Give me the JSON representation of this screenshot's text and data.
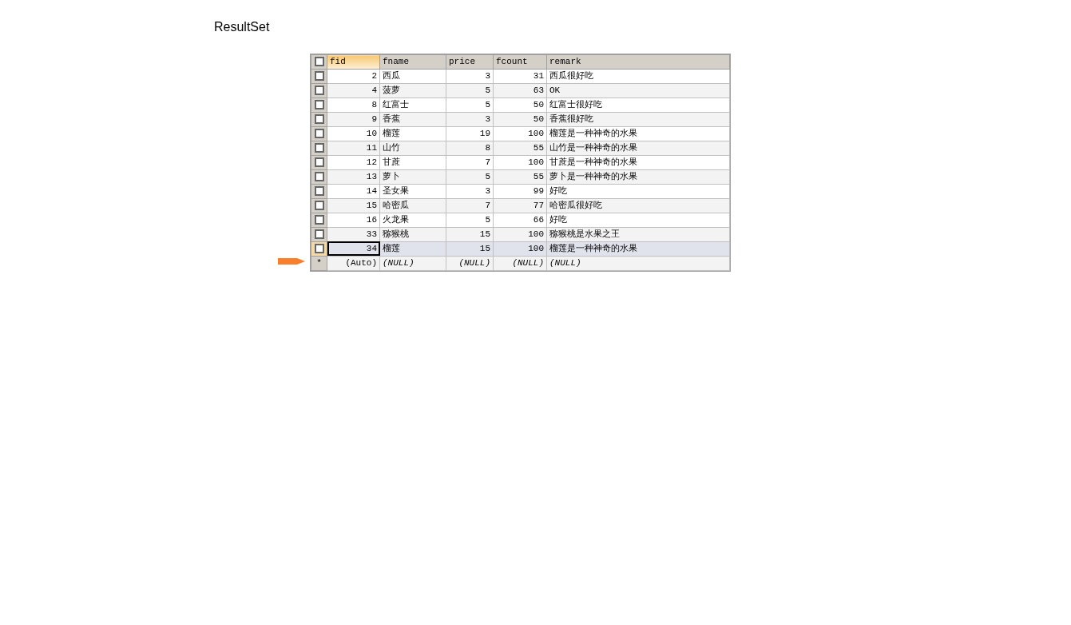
{
  "title": "ResultSet",
  "header_checkbox": {
    "checked": false
  },
  "columns": [
    {
      "label": "fid",
      "selected": true,
      "kind": "number"
    },
    {
      "label": "fname",
      "selected": false,
      "kind": "text"
    },
    {
      "label": "price",
      "selected": false,
      "kind": "number"
    },
    {
      "label": "fcount",
      "selected": false,
      "kind": "number"
    },
    {
      "label": "remark",
      "selected": false,
      "kind": "text"
    }
  ],
  "rows": [
    {
      "cells": [
        "2",
        "西瓜",
        "3",
        "31",
        "西瓜很好吃"
      ],
      "selected": false,
      "checked": false
    },
    {
      "cells": [
        "4",
        "菠萝",
        "5",
        "63",
        "OK"
      ],
      "selected": false,
      "checked": false
    },
    {
      "cells": [
        "8",
        "红富士",
        "5",
        "50",
        "红富士很好吃"
      ],
      "selected": false,
      "checked": false
    },
    {
      "cells": [
        "9",
        "香蕉",
        "3",
        "50",
        "香蕉很好吃"
      ],
      "selected": false,
      "checked": false
    },
    {
      "cells": [
        "10",
        "榴莲",
        "19",
        "100",
        "榴莲是一种神奇的水果"
      ],
      "selected": false,
      "checked": false
    },
    {
      "cells": [
        "11",
        "山竹",
        "8",
        "55",
        "山竹是一种神奇的水果"
      ],
      "selected": false,
      "checked": false
    },
    {
      "cells": [
        "12",
        "甘蔗",
        "7",
        "100",
        "甘蔗是一种神奇的水果"
      ],
      "selected": false,
      "checked": false
    },
    {
      "cells": [
        "13",
        "萝卜",
        "5",
        "55",
        "萝卜是一种神奇的水果"
      ],
      "selected": false,
      "checked": false
    },
    {
      "cells": [
        "14",
        "圣女果",
        "3",
        "99",
        "好吃"
      ],
      "selected": false,
      "checked": false
    },
    {
      "cells": [
        "15",
        "哈密瓜",
        "7",
        "77",
        "哈密瓜很好吃"
      ],
      "selected": false,
      "checked": false
    },
    {
      "cells": [
        "16",
        "火龙果",
        "5",
        "66",
        "好吃"
      ],
      "selected": false,
      "checked": false
    },
    {
      "cells": [
        "33",
        "猕猴桃",
        "15",
        "100",
        "猕猴桃是水果之王"
      ],
      "selected": false,
      "checked": false
    },
    {
      "cells": [
        "34",
        "榴莲",
        "15",
        "100",
        "榴莲是一种神奇的水果"
      ],
      "selected": true,
      "checked": false
    }
  ],
  "new_row": {
    "marker": "*",
    "cells": [
      "(Auto)",
      "(NULL)",
      "(NULL)",
      "(NULL)",
      "(NULL)"
    ]
  }
}
